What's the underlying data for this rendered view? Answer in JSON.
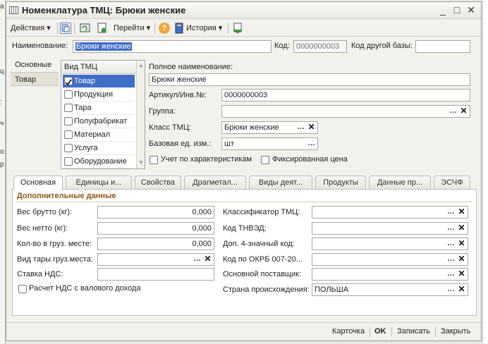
{
  "left_strip": [
    "а",
    "ц",
    ":",
    "ч",
    "о",
    "р"
  ],
  "window": {
    "title": "Номенклатура ТМЦ: Брюки женские",
    "min": "_",
    "max": "□",
    "close": "✕"
  },
  "toolbar": {
    "actions": "Действия",
    "goto": "Перейти",
    "history": "История",
    "help": "?"
  },
  "header": {
    "name_label": "Наименование:",
    "name_value": "Брюки женские",
    "code_label": "Код:",
    "code_value": "0000000003",
    "other_code_label": "Код другой базы:",
    "other_code_value": ""
  },
  "side_tabs": [
    "Основные",
    "Товар"
  ],
  "type_list": {
    "header": "Вид ТМЦ",
    "items": [
      {
        "label": "Товар",
        "checked": true,
        "selected": true
      },
      {
        "label": "Продукция",
        "checked": false
      },
      {
        "label": "Тара",
        "checked": false
      },
      {
        "label": "Полуфабрикат",
        "checked": false
      },
      {
        "label": "Материал",
        "checked": false
      },
      {
        "label": "Услуга",
        "checked": false
      },
      {
        "label": "Оборудование",
        "checked": false
      }
    ]
  },
  "details": {
    "full_name_label": "Полное наименование:",
    "full_name_value": "Брюки женские",
    "article_label": "Артикул/Инв.№:",
    "article_value": "0000000003",
    "group_label": "Группа:",
    "group_value": "",
    "class_label": "Класс ТМЦ:",
    "class_value": "Брюки женские",
    "unit_label": "Базовая ед. изм.:",
    "unit_value": "шт",
    "by_characteristics": "Учет по характеристикам",
    "fixed_price": "Фиксированная цена"
  },
  "tabs": [
    "Основная",
    "Единицы и...",
    "Свойства",
    "Драгметал...",
    "Виды деят...",
    "Продукты",
    "Данные пр...",
    "ЭСЧФ"
  ],
  "section_title": "Дополнительные данные",
  "left_fields": [
    {
      "label": "Вес брутто (кг):",
      "value": "0,000"
    },
    {
      "label": "Вес нетто (кг):",
      "value": "0,000"
    },
    {
      "label": "Кол-во в груз. месте:",
      "value": "0,000"
    },
    {
      "label": "Вид тары груз.места:",
      "value": ""
    },
    {
      "label": "Ставка НДС:",
      "value": ""
    }
  ],
  "vat_checkbox": "Расчет НДС с валового дохода",
  "right_fields": [
    {
      "label": "Классификатор ТМЦ:",
      "value": ""
    },
    {
      "label": "Код ТНВЭД:",
      "value": ""
    },
    {
      "label": "Доп. 4-значный код:",
      "value": ""
    },
    {
      "label": "Код по ОКРБ 007-20...",
      "value": ""
    },
    {
      "label": "Основной поставщик:",
      "value": ""
    },
    {
      "label": "Страна происхождения:",
      "value": "ПОЛЬША"
    }
  ],
  "footer": {
    "card": "Карточка",
    "ok": "OK",
    "save": "Записать",
    "close": "Закрыть"
  }
}
